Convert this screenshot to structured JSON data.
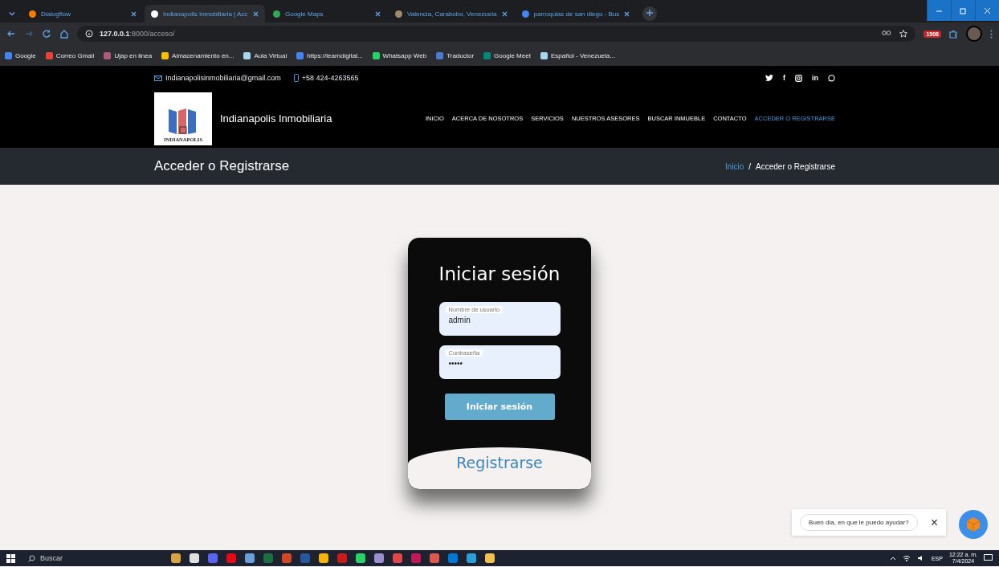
{
  "browser": {
    "tabs": [
      {
        "title": "Dialogflow",
        "selected": false
      },
      {
        "title": "Indianapolis Inmobiliaria | Acc",
        "selected": true
      },
      {
        "title": "Google Maps",
        "selected": false
      },
      {
        "title": "Valencia, Carabobo, Venezuela",
        "selected": false
      },
      {
        "title": "parroquias de san diego - Bus",
        "selected": false
      }
    ],
    "address": {
      "host": "127.0.0.1",
      "path": ":8000/acceso/"
    },
    "bookmarks": [
      {
        "label": "Google",
        "color": "#4285f4"
      },
      {
        "label": "Correo Gmail",
        "color": "#ea4335"
      },
      {
        "label": "Ujap en linea",
        "color": "#b05a7a"
      },
      {
        "label": "Almacenamiento en...",
        "color": "#fbbc04"
      },
      {
        "label": "Aula Virtual",
        "color": "#a8d8f0"
      },
      {
        "label": "https://learndigital...",
        "color": "#4285f4"
      },
      {
        "label": "Whatsapp Web",
        "color": "#25d366"
      },
      {
        "label": "Traductor",
        "color": "#4a7bd0"
      },
      {
        "label": "Google Meet",
        "color": "#00897b"
      },
      {
        "label": "Español - Venezuela...",
        "color": "#a8d8f0"
      }
    ],
    "extension_badge": "1508"
  },
  "site": {
    "email": "Indianapolisinmobiliaria@gmail.com",
    "phone": "+58 424-4263565",
    "social": [
      {
        "kind": "twitter"
      },
      {
        "kind": "text",
        "label": "f"
      },
      {
        "kind": "instagram"
      },
      {
        "kind": "text",
        "label": "in"
      },
      {
        "kind": "whatsapp"
      }
    ],
    "logo_text": "INDIANAPOLIS",
    "brand": "Indianapolis Inmobiliaria",
    "nav": [
      {
        "label": "INICIO",
        "selected": false
      },
      {
        "label": "ACERCA DE NOSOTROS",
        "selected": false
      },
      {
        "label": "SERVICIOS",
        "selected": false
      },
      {
        "label": "NUESTROS ASESORES",
        "selected": false
      },
      {
        "label": "BUSCAR INMUEBLE",
        "selected": false
      },
      {
        "label": "CONTACTO",
        "selected": false
      },
      {
        "label": "ACCEDER O REGISTRARSE",
        "selected": true
      }
    ],
    "page_title": "Acceder o Registrarse",
    "breadcrumb": [
      {
        "label": "Inicio",
        "kind": "link"
      },
      {
        "label": "/",
        "kind": "separator"
      },
      {
        "label": "Acceder o Registrarse",
        "kind": "current"
      }
    ]
  },
  "login": {
    "title": "Iniciar sesión",
    "fields": [
      {
        "label": "Nombre de usuario",
        "value": "admin"
      },
      {
        "label": "Contraseña",
        "value": "•••••"
      }
    ],
    "submit": "Iniciar sesión",
    "register": "Registrarse"
  },
  "chat": {
    "message": "Buen dia, en que le puedo ayudar?",
    "close": "×"
  },
  "taskbar": {
    "search": "Buscar",
    "language": "ESP",
    "time": "12:22 a. m.",
    "date": "7/4/2024"
  }
}
